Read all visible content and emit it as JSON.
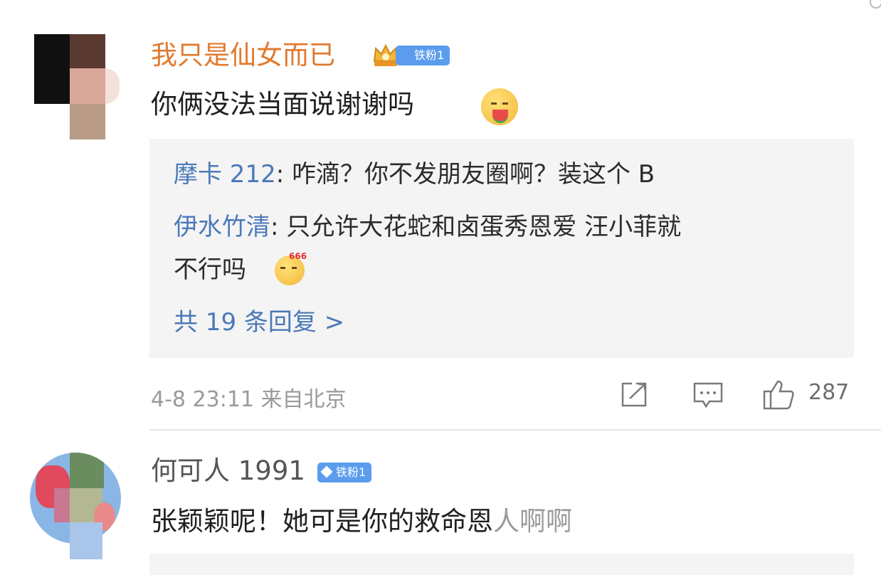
{
  "comments": [
    {
      "username": "我只是仙女而已",
      "badge": "铁粉1",
      "text": "你俩没法当面说谢谢吗",
      "replies": [
        {
          "name": "摩卡 212",
          "text": ": 咋滴？你不发朋友圈啊？装这个 B"
        },
        {
          "name": "伊水竹清",
          "text": ": 只允许大花蛇和卤蛋秀恩爱 汪小菲就",
          "text2": "不行吗"
        }
      ],
      "more_replies": "共 19 条回复 >",
      "meta": "4-8 23:11 来自北京",
      "likes": "287"
    },
    {
      "username": "何可人 1991",
      "badge": "铁粉1",
      "text": "张颖颖呢！她可是你的救命恩人啊啊"
    }
  ],
  "icons": {
    "share": "share-icon",
    "comment": "comment-icon",
    "like": "thumbs-up-icon"
  },
  "colors": {
    "username_orange": "#e07a2e",
    "link_blue": "#4a79b8",
    "badge_blue": "#5b9cef",
    "reply_bg": "#f4f4f4",
    "meta_gray": "#9a9a9a"
  }
}
